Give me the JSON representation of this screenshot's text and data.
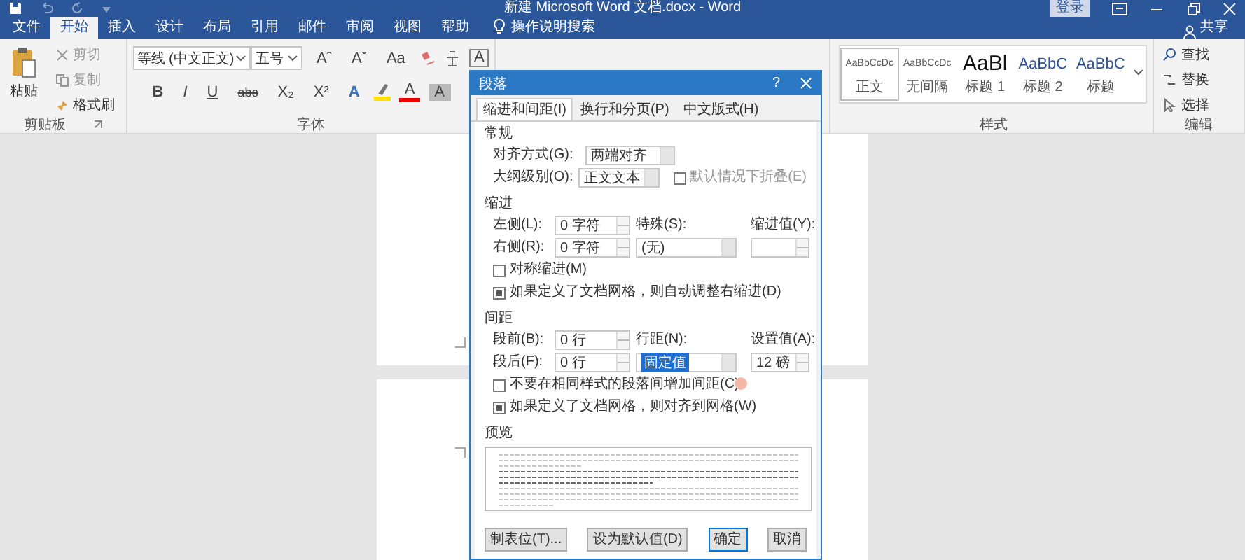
{
  "window": {
    "title": "新建 Microsoft Word 文档.docx - Word",
    "login": "登录"
  },
  "ribbon_tabs": [
    {
      "label": "文件",
      "selected": false
    },
    {
      "label": "开始",
      "selected": true
    },
    {
      "label": "插入",
      "selected": false
    },
    {
      "label": "设计",
      "selected": false
    },
    {
      "label": "布局",
      "selected": false
    },
    {
      "label": "引用",
      "selected": false
    },
    {
      "label": "邮件",
      "selected": false
    },
    {
      "label": "审阅",
      "selected": false
    },
    {
      "label": "视图",
      "selected": false
    },
    {
      "label": "帮助",
      "selected": false
    }
  ],
  "tell_me": "操作说明搜索",
  "share": "共享",
  "clipboard": {
    "paste": "粘贴",
    "group_label": "剪贴板",
    "items": [
      {
        "label": "剪切",
        "kind": "cut",
        "disabled": true
      },
      {
        "label": "复制",
        "kind": "copy",
        "disabled": true
      },
      {
        "label": "格式刷",
        "kind": "brush",
        "disabled": false
      }
    ]
  },
  "font": {
    "name": "等线 (中文正文)",
    "size": "五号",
    "group_label": "字体",
    "row1": [
      {
        "kind": "grow",
        "text": "Aˆ"
      },
      {
        "kind": "shrink",
        "text": "Aˇ"
      },
      {
        "kind": "case",
        "text": "Aa"
      },
      {
        "kind": "clear"
      },
      {
        "kind": "pinyin"
      },
      {
        "kind": "border",
        "text": "A"
      }
    ],
    "row2": [
      {
        "kind": "bold",
        "text": "B"
      },
      {
        "kind": "italic",
        "text": "I"
      },
      {
        "kind": "underline",
        "text": "U"
      },
      {
        "kind": "strike",
        "text": "abc"
      },
      {
        "kind": "sub",
        "text": "X₂"
      },
      {
        "kind": "sup",
        "text": "X²"
      },
      {
        "kind": "effects",
        "text": "A"
      },
      {
        "kind": "highlight"
      },
      {
        "kind": "color",
        "text": "A"
      },
      {
        "kind": "shade",
        "text": "A"
      }
    ]
  },
  "styles": {
    "group_label": "样式",
    "items": [
      {
        "preview": "AaBbCcDc",
        "name": "正文",
        "kind": "small",
        "selected": true
      },
      {
        "preview": "AaBbCcDc",
        "name": "无间隔",
        "kind": "small",
        "selected": false
      },
      {
        "preview": "AaBl",
        "name": "标题 1",
        "kind": "large",
        "selected": false
      },
      {
        "preview": "AaBbC",
        "name": "标题 2",
        "kind": "medium",
        "selected": false
      },
      {
        "preview": "AaBbC",
        "name": "标题",
        "kind": "medium",
        "selected": false
      }
    ]
  },
  "editing": {
    "group_label": "编辑",
    "items": [
      {
        "label": "查找",
        "kind": "find"
      },
      {
        "label": "替换",
        "kind": "replace"
      },
      {
        "label": "选择",
        "kind": "select"
      }
    ]
  },
  "dialog": {
    "title": "段落",
    "help": "?",
    "tabs": [
      {
        "label": "缩进和间距(I)",
        "selected": true
      },
      {
        "label": "换行和分页(P)",
        "selected": false
      },
      {
        "label": "中文版式(H)",
        "selected": false
      }
    ],
    "general": {
      "heading": "常规",
      "alignment": {
        "label": "对齐方式(G):",
        "value": "两端对齐"
      },
      "outline": {
        "label": "大纲级别(O):",
        "value": "正文文本"
      },
      "collapse": {
        "label": "默认情况下折叠(E)",
        "checked": false,
        "disabled": true
      }
    },
    "indent": {
      "heading": "缩进",
      "left": {
        "label": "左侧(L):",
        "value": "0 字符"
      },
      "right": {
        "label": "右侧(R):",
        "value": "0 字符"
      },
      "special": {
        "label": "特殊(S):",
        "value": "(无)"
      },
      "by": {
        "label": "缩进值(Y):"
      },
      "options": [
        {
          "label": "对称缩进(M)",
          "checked": false
        },
        {
          "label": "如果定义了文档网格，则自动调整右缩进(D)",
          "checked": true
        }
      ]
    },
    "spacing": {
      "heading": "间距",
      "before": {
        "label": "段前(B):",
        "value": "0 行"
      },
      "after": {
        "label": "段后(F):",
        "value": "0 行"
      },
      "line": {
        "label": "行距(N):",
        "value": "固定值",
        "highlighted": true
      },
      "at": {
        "label": "设置值(A):",
        "value": "12 磅"
      },
      "options": [
        {
          "label": "不要在相同样式的段落间增加间距(C)",
          "checked": false
        },
        {
          "label": "如果定义了文档网格，则对齐到网格(W)",
          "checked": true
        }
      ]
    },
    "preview": {
      "heading": "预览"
    },
    "buttons": [
      "制表位(T)...",
      "设为默认值(D)",
      "确定",
      "取消"
    ]
  }
}
